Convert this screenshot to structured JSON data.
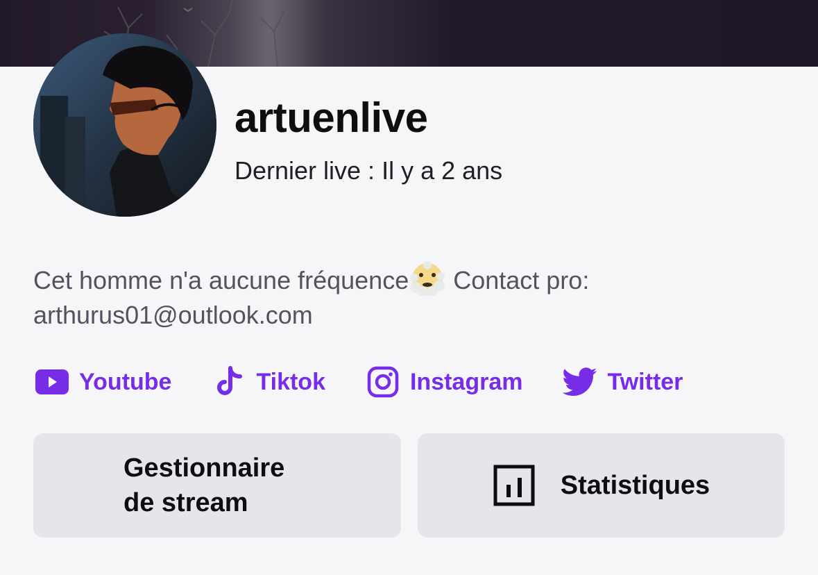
{
  "profile": {
    "username": "artuenlive",
    "last_live": "Dernier live : Il y a 2 ans",
    "bio_text_before": "Cet homme n'a aucune fréquence",
    "bio_text_after": " Contact pro: arthurus01@outlook.com"
  },
  "socials": [
    {
      "label": "Youtube",
      "icon": "youtube-icon"
    },
    {
      "label": "Tiktok",
      "icon": "tiktok-icon"
    },
    {
      "label": "Instagram",
      "icon": "instagram-icon"
    },
    {
      "label": "Twitter",
      "icon": "twitter-icon"
    }
  ],
  "actions": {
    "stream_manager": "Gestionnaire de stream",
    "statistics": "Statistiques"
  },
  "colors": {
    "accent": "#772ce8",
    "background": "#f6f6f8",
    "button_bg": "#e6e6ea",
    "text_primary": "#0e0e10",
    "text_secondary": "#53535f"
  }
}
